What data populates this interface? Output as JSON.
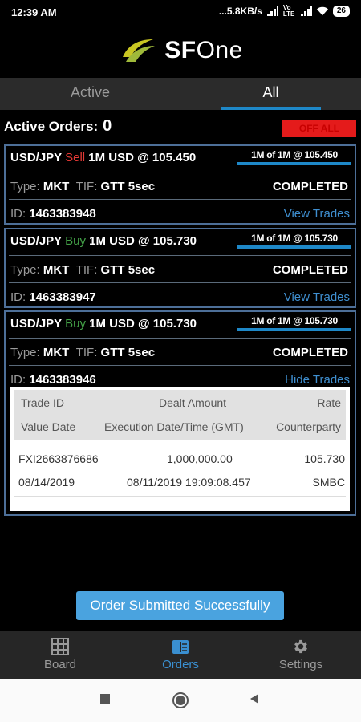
{
  "status_bar": {
    "time": "12:39 AM",
    "network": "...5.8KB/s",
    "lte": "Vo LTE",
    "battery": "26"
  },
  "app": {
    "brand_prefix": "SF",
    "brand_suffix": "One"
  },
  "tabs": [
    {
      "label": "Active"
    },
    {
      "label": "All"
    }
  ],
  "active_tab": "All",
  "header": {
    "active_orders_label": "Active Orders:",
    "active_orders_count": "0",
    "off_all_label": "OFF ALL"
  },
  "orders": [
    {
      "pair": "USD/JPY",
      "side": "Sell",
      "size": "1M USD",
      "price": "@ 105.450",
      "fill_text": "1M of 1M @ 105.450",
      "fill_ratio": 1,
      "type_label": "Type:",
      "type": "MKT",
      "tif_label": "TIF:",
      "tif": "GTT 5sec",
      "status": "COMPLETED",
      "id_label": "ID:",
      "id": "1463383948",
      "link": "View Trades"
    },
    {
      "pair": "USD/JPY",
      "side": "Buy",
      "size": "1M USD",
      "price": "@ 105.730",
      "fill_text": "1M of 1M @ 105.730",
      "fill_ratio": 1,
      "type_label": "Type:",
      "type": "MKT",
      "tif_label": "TIF:",
      "tif": "GTT 5sec",
      "status": "COMPLETED",
      "id_label": "ID:",
      "id": "1463383947",
      "link": "View Trades"
    },
    {
      "pair": "USD/JPY",
      "side": "Buy",
      "size": "1M USD",
      "price": "@ 105.730",
      "fill_text": "1M of 1M @ 105.730",
      "fill_ratio": 1,
      "type_label": "Type:",
      "type": "MKT",
      "tif_label": "TIF:",
      "tif": "GTT 5sec",
      "status": "COMPLETED",
      "id_label": "ID:",
      "id": "1463383946",
      "link": "Hide Trades"
    }
  ],
  "trades_table": {
    "headers": {
      "trade_id": "Trade ID",
      "dealt_amount": "Dealt Amount",
      "rate": "Rate",
      "value_date": "Value Date",
      "execution": "Execution Date/Time (GMT)",
      "counterparty": "Counterparty"
    },
    "rows": [
      {
        "trade_id": "FXI2663876686",
        "dealt_amount": "1,000,000.00",
        "rate": "105.730",
        "value_date": "08/14/2019",
        "execution": "08/11/2019 19:09:08.457",
        "counterparty": "SMBC"
      }
    ]
  },
  "toast": "Order Submitted Successfully",
  "bottom_nav": [
    {
      "label": "Board",
      "icon": "grid-icon"
    },
    {
      "label": "Orders",
      "icon": "orders-icon"
    },
    {
      "label": "Settings",
      "icon": "gear-icon"
    }
  ],
  "active_nav": "Orders",
  "colors": {
    "accent": "#1e88c8",
    "sell": "#e53935",
    "buy": "#43a047",
    "link": "#3f8fd0",
    "off_all": "#e41b1b",
    "card_border": "#4d6f98"
  }
}
